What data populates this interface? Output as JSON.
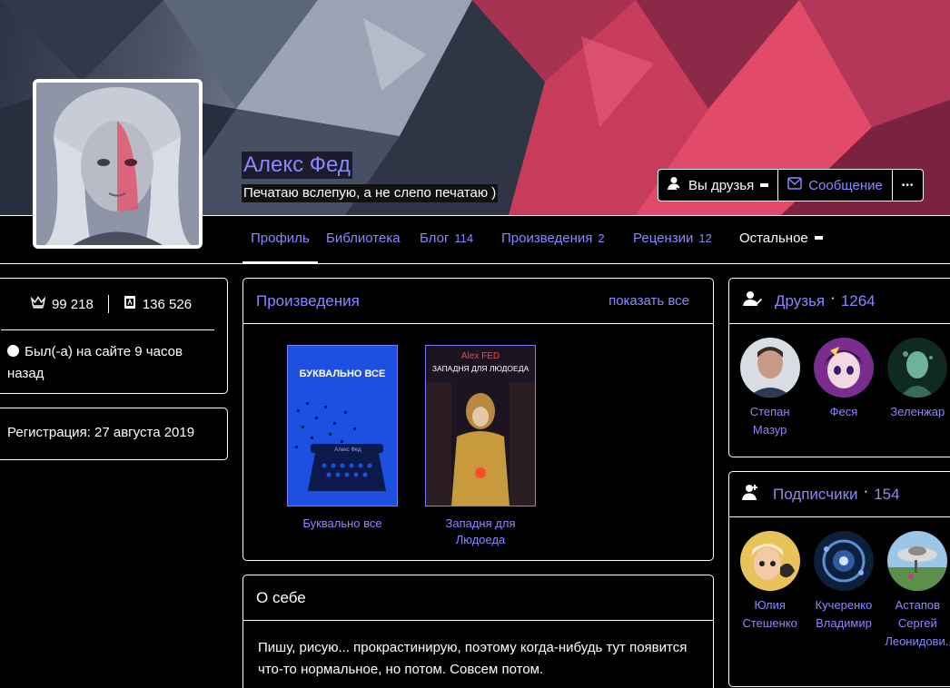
{
  "profile": {
    "name": "Алекс Фед",
    "status": "Печатаю вслепую, а не слепо печатаю )"
  },
  "actions": {
    "friends_label": "Вы друзья",
    "message_label": "Сообщение",
    "more_label": "•••"
  },
  "tabs": [
    {
      "label": "Профиль",
      "count": ""
    },
    {
      "label": "Библиотека",
      "count": ""
    },
    {
      "label": "Блог",
      "count": "114"
    },
    {
      "label": "Произведения",
      "count": "2"
    },
    {
      "label": "Рецензии",
      "count": "12"
    },
    {
      "label": "Остальное",
      "count": ""
    }
  ],
  "stats": {
    "rating": "99 218",
    "achievement": "136 526",
    "online": "Был(-а) на сайте 9 часов назад",
    "registration": "Регистрация: 27 августа 2019"
  },
  "works": {
    "title": "Произведения",
    "show_all": "показать все",
    "items": [
      {
        "title": "Буквально все",
        "cover_text": "БУКВАЛЬНО ВСЕ",
        "cover_author": "Алекс Фед"
      },
      {
        "title": "Западня для Людоеда",
        "cover_text": "ЗАПАДНЯ ДЛЯ ЛЮДОЕДА",
        "cover_author": "Alex FED"
      }
    ]
  },
  "about": {
    "title": "О себе",
    "text": "Пишу, рисую... прокрастинирую, поэтому когда-нибудь тут появится что-то нормальное, но потом. Совсем потом."
  },
  "friends": {
    "title": "Друзья",
    "count": "1264",
    "items": [
      {
        "name": "Степан Мазур"
      },
      {
        "name": "Феся"
      },
      {
        "name": "Зеленжар"
      }
    ]
  },
  "followers": {
    "title": "Подписчики",
    "count": "154",
    "items": [
      {
        "name": "Юлия Стешенко"
      },
      {
        "name": "Кучеренко Владимир"
      },
      {
        "name": "Астапов Сергей Леонидови..."
      }
    ]
  },
  "colors": {
    "accent": "#8b87ff",
    "background": "#000000",
    "border": "#ffffff"
  }
}
